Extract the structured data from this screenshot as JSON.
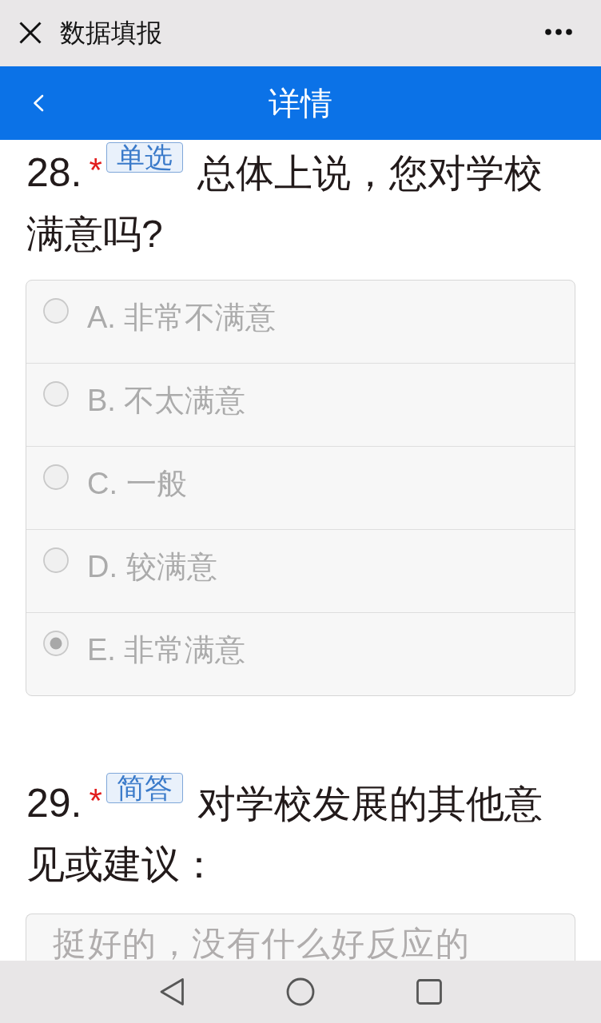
{
  "top_bar": {
    "title": "数据填报"
  },
  "nav_bar": {
    "title": "详情"
  },
  "questions": [
    {
      "kind": "single_choice",
      "number": "28.",
      "required_mark": "*",
      "tag": "单选",
      "text": "总体上说，您对学校满意吗?",
      "disabled": true,
      "options": [
        {
          "label": "A. 非常不满意",
          "selected": false
        },
        {
          "label": "B. 不太满意",
          "selected": false
        },
        {
          "label": "C. 一般",
          "selected": false
        },
        {
          "label": "D. 较满意",
          "selected": false
        },
        {
          "label": "E. 非常满意",
          "selected": true
        }
      ]
    },
    {
      "kind": "short_answer",
      "number": "29.",
      "required_mark": "*",
      "tag": "简答",
      "text": "对学校发展的其他意见或建议：",
      "disabled": true,
      "value": "挺好的，没有什么好反应的"
    }
  ]
}
